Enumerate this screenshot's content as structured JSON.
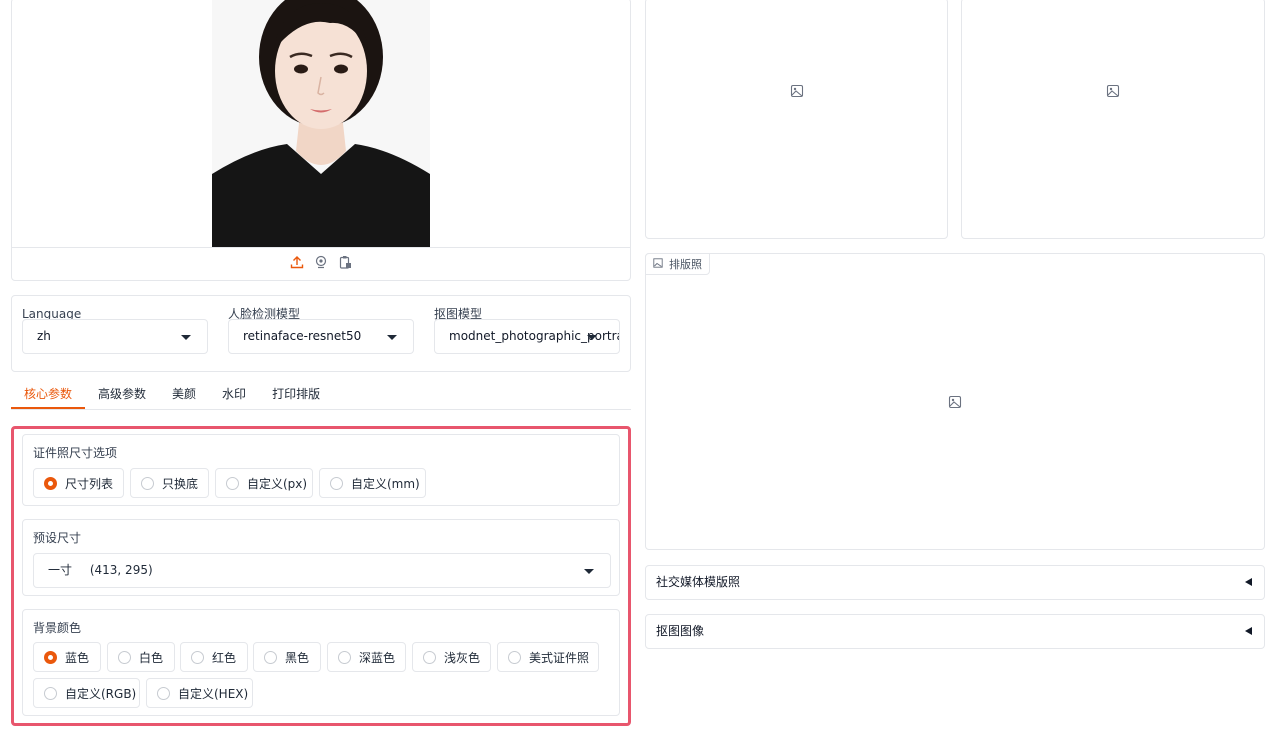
{
  "models": {
    "language": {
      "label": "Language",
      "value": "zh"
    },
    "face_detect": {
      "label": "人脸检测模型",
      "value": "retinaface-resnet50"
    },
    "matting": {
      "label": "抠图模型",
      "value": "modnet_photographic_portrait"
    }
  },
  "tabs": [
    {
      "label": "核心参数",
      "active": true
    },
    {
      "label": "高级参数",
      "active": false
    },
    {
      "label": "美颜",
      "active": false
    },
    {
      "label": "水印",
      "active": false
    },
    {
      "label": "打印排版",
      "active": false
    }
  ],
  "size_options": {
    "title": "证件照尺寸选项",
    "options": [
      "尺寸列表",
      "只换底",
      "自定义(px)",
      "自定义(mm)"
    ],
    "selected": "尺寸列表"
  },
  "preset_size": {
    "title": "预设尺寸",
    "value_name": "一寸",
    "value_dims": "(413, 295)"
  },
  "background": {
    "title": "背景颜色",
    "options": [
      "蓝色",
      "白色",
      "红色",
      "黑色",
      "深蓝色",
      "浅灰色",
      "美式证件照",
      "自定义(RGB)",
      "自定义(HEX)"
    ],
    "selected": "蓝色"
  },
  "right": {
    "layout_tag": "排版照",
    "accordion_social": "社交媒体模版照",
    "accordion_matting": "抠图图像"
  },
  "colors": {
    "accent": "#ea580c",
    "highlight_border": "#e8566d",
    "border": "#e5e7eb"
  },
  "icons": [
    "upload-icon",
    "webcam-icon",
    "clipboard-icon",
    "image-placeholder-icon",
    "dropdown-caret-icon",
    "collapse-arrow-icon"
  ]
}
